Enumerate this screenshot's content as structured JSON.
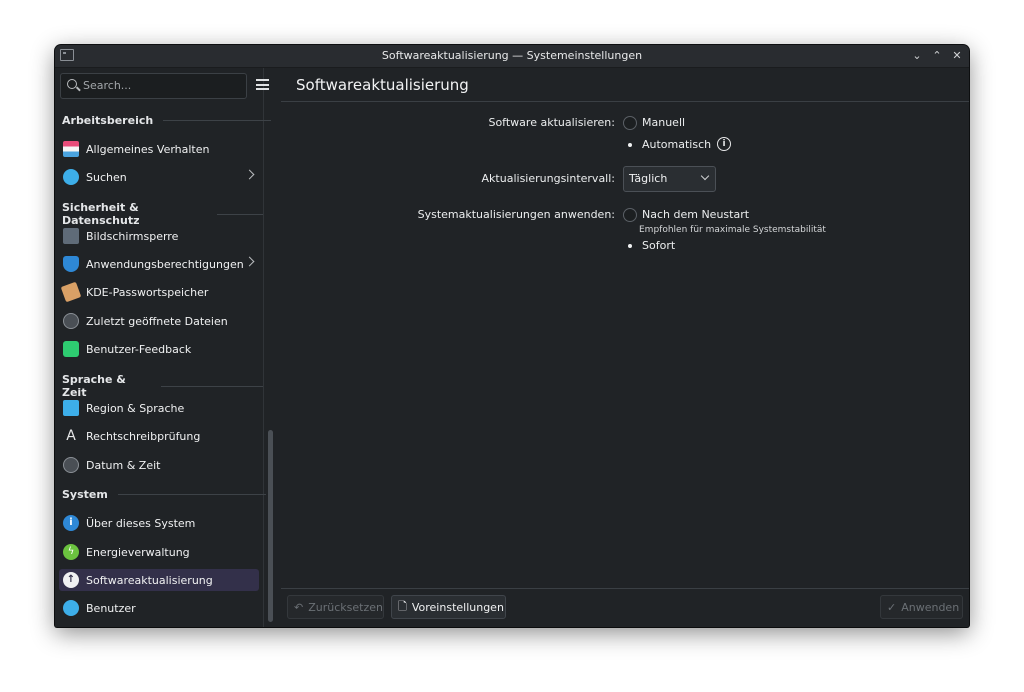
{
  "window": {
    "title": "Softwareaktualisierung — Systemeinstellungen"
  },
  "search": {
    "placeholder": "Search..."
  },
  "sidebar": {
    "sections": [
      {
        "title": "Arbeitsbereich"
      },
      {
        "title": "Sicherheit & Datenschutz"
      },
      {
        "title": "Sprache & Zeit"
      },
      {
        "title": "System"
      }
    ],
    "items": [
      {
        "label": "Allgemeines Verhalten",
        "icon": "general-behavior-icon"
      },
      {
        "label": "Suchen",
        "icon": "search-app-icon"
      },
      {
        "label": "Bildschirmsperre",
        "icon": "screen-lock-icon"
      },
      {
        "label": "Anwendungsberechtigungen",
        "icon": "shield-icon"
      },
      {
        "label": "KDE-Passwortspeicher",
        "icon": "wallet-icon"
      },
      {
        "label": "Zuletzt geöffnete Dateien",
        "icon": "clock-icon"
      },
      {
        "label": "Benutzer-Feedback",
        "icon": "feedback-icon"
      },
      {
        "label": "Region & Sprache",
        "icon": "region-icon"
      },
      {
        "label": "Rechtschreibprüfung",
        "icon": "spellcheck-icon"
      },
      {
        "label": "Datum & Zeit",
        "icon": "clock-icon"
      },
      {
        "label": "Über dieses System",
        "icon": "info-icon"
      },
      {
        "label": "Energieverwaltung",
        "icon": "power-icon"
      },
      {
        "label": "Softwareaktualisierung",
        "icon": "update-icon"
      },
      {
        "label": "Benutzer",
        "icon": "users-icon"
      }
    ],
    "active": "Softwareaktualisierung"
  },
  "page": {
    "title": "Softwareaktualisierung",
    "update_label": "Software aktualisieren:",
    "update_options": [
      "Manuell",
      "Automatisch"
    ],
    "update_selected": "Automatisch",
    "interval_label": "Aktualisierungsintervall:",
    "interval_value": "Täglich",
    "apply_label": "Systemaktualisierungen anwenden:",
    "apply_options": [
      "Nach dem Neustart",
      "Sofort"
    ],
    "apply_hint": "Empfohlen für maximale Systemstabilität",
    "apply_selected": "Sofort"
  },
  "footer": {
    "reset_label": "Zurücksetzen",
    "defaults_label": "Voreinstellungen",
    "apply_label": "Anwenden"
  },
  "colors": {
    "accent": "#33304a",
    "background": "#202326"
  }
}
